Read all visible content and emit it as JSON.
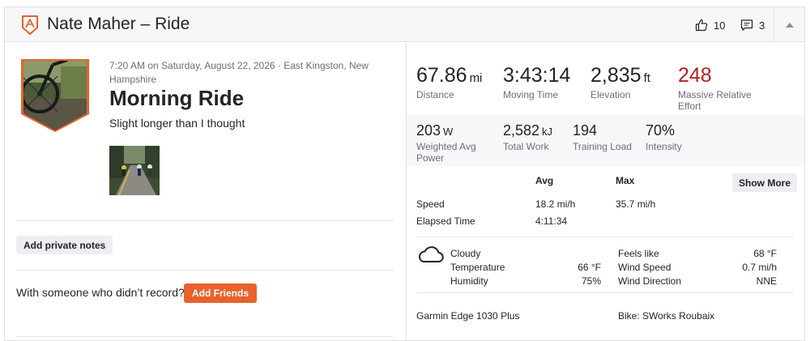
{
  "header": {
    "title": "Nate Maher – Ride",
    "kudos_count": "10",
    "comment_count": "3"
  },
  "activity": {
    "meta": "7:20 AM on Saturday, August 22, 2026 · East Kingston, New Hampshire",
    "title": "Morning Ride",
    "description": "Slight longer than I thought",
    "add_notes_label": "Add private notes",
    "friends_prompt": "With someone who didn’t record?",
    "add_friends_label": "Add Friends"
  },
  "primary_stats": [
    {
      "value": "67.86",
      "unit": "mi",
      "label": "Distance"
    },
    {
      "value": "3:43:14",
      "unit": "",
      "label": "Moving Time"
    },
    {
      "value": "2,835",
      "unit": "ft",
      "label": "Elevation"
    },
    {
      "value": "248",
      "unit": "",
      "label": "Massive Relative Effort"
    }
  ],
  "secondary_stats": [
    {
      "value": "203",
      "unit": "W",
      "label": "Weighted Avg Power"
    },
    {
      "value": "2,582",
      "unit": "kJ",
      "label": "Total Work"
    },
    {
      "value": "194",
      "unit": "",
      "label": "Training Load"
    },
    {
      "value": "70%",
      "unit": "",
      "label": "Intensity"
    }
  ],
  "details_table": {
    "col_avg": "Avg",
    "col_max": "Max",
    "show_more_label": "Show More",
    "rows": [
      {
        "label": "Speed",
        "avg": "18.2 mi/h",
        "max": "35.7 mi/h"
      },
      {
        "label": "Elapsed Time",
        "avg": "4:11:34",
        "max": ""
      }
    ]
  },
  "weather": {
    "icon": "cloud-icon",
    "condition": "Cloudy",
    "temperature_label": "Temperature",
    "temperature_value": "66 °F",
    "humidity_label": "Humidity",
    "humidity_value": "75%",
    "feels_like_label": "Feels like",
    "feels_like_value": "68 °F",
    "wind_speed_label": "Wind Speed",
    "wind_speed_value": "0.7 mi/h",
    "wind_direction_label": "Wind Direction",
    "wind_direction_value": "NNE"
  },
  "gear": {
    "device": "Garmin Edge 1030 Plus",
    "bike": "Bike: SWorks Roubaix"
  },
  "colors": {
    "brand_orange": "#e8622b",
    "relative_effort_red": "#b3211f",
    "text": "#242428",
    "muted_text": "#6d6d78"
  }
}
